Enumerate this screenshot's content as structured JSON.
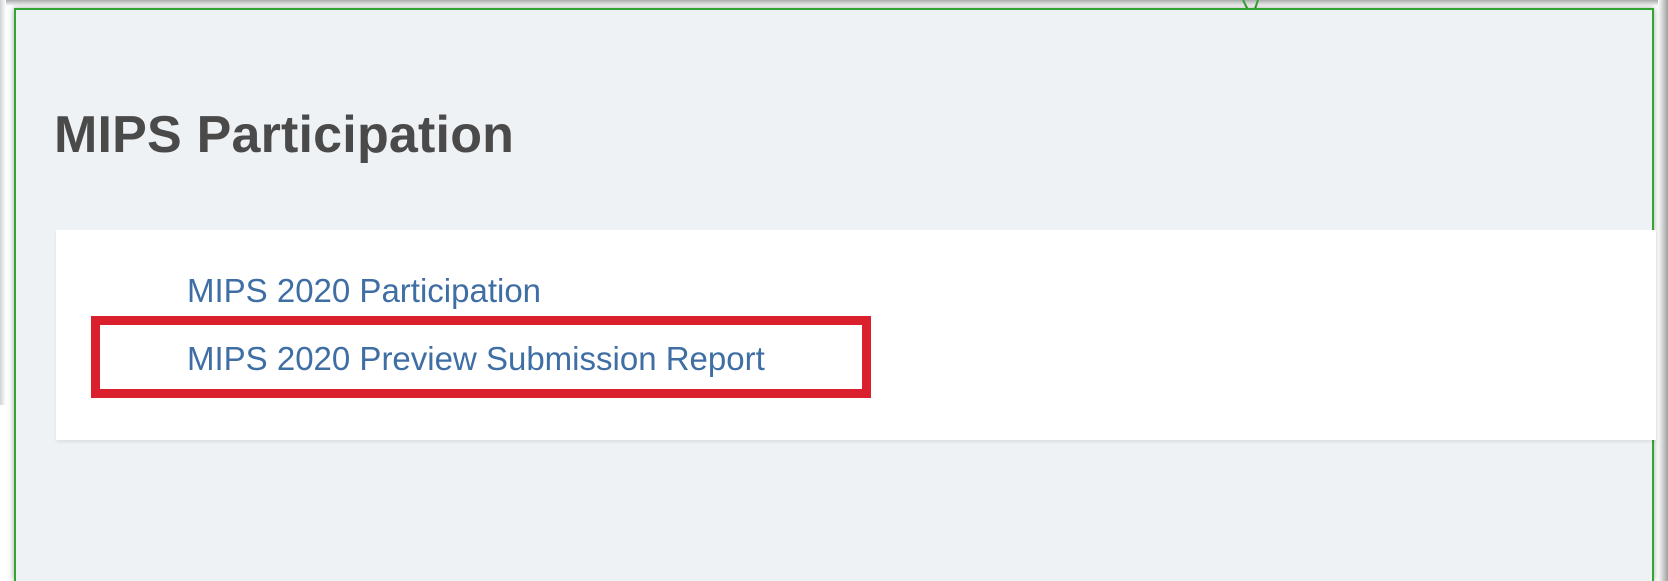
{
  "page": {
    "title": "MIPS Participation"
  },
  "links": [
    {
      "label": "MIPS 2020 Participation"
    },
    {
      "label": "MIPS 2020 Preview Submission Report"
    }
  ],
  "colors": {
    "page_background": "#eff2f5",
    "title_text": "#4a4a4a",
    "link_text": "#3e6ea3",
    "highlight_border": "#d9202c",
    "frame_border": "#33a532"
  },
  "annotation": {
    "highlighted_item": "MIPS 2020 Preview Submission Report"
  }
}
